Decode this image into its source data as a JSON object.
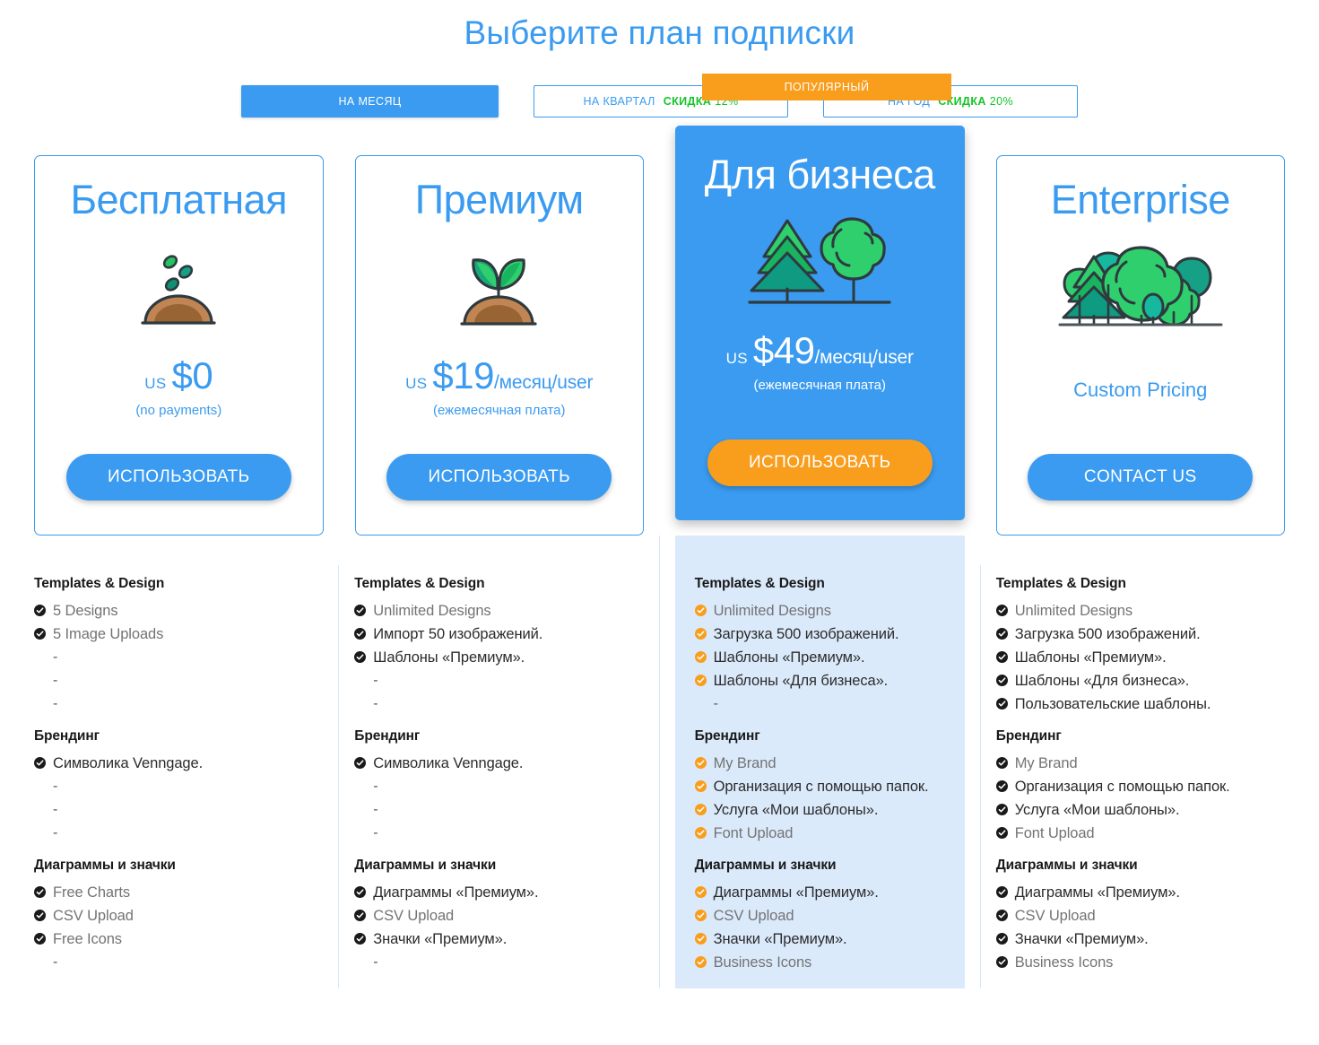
{
  "header": {
    "title": "Выберите план подписки"
  },
  "billing": {
    "options": [
      {
        "label": "НА МЕСЯЦ",
        "discount_word": "",
        "discount_value": "",
        "active": true
      },
      {
        "label": "НА КВАРТАЛ",
        "discount_word": "СКИДКА",
        "discount_value": "12%",
        "active": false
      },
      {
        "label": "НА ГОД",
        "discount_word": "СКИДКА",
        "discount_value": "20%",
        "active": false
      }
    ]
  },
  "colors": {
    "accent_blue": "#3a9bf0",
    "accent_orange": "#f99d1c",
    "discount_green": "#16c42b",
    "highlight_bg": "#dbeafb"
  },
  "plans": [
    {
      "name": "Бесплатная",
      "illustration": "seeds-on-soil-icon",
      "currency": "US",
      "price": "$0",
      "period": "",
      "note": "(no payments)",
      "cta_label": "ИСПОЛЬЗОВАТЬ",
      "cta_style": "blue",
      "badge": "",
      "featured": false
    },
    {
      "name": "Премиум",
      "illustration": "sprout-icon",
      "currency": "US",
      "price": "$19",
      "period": "/месяц/user",
      "note": "(ежемесячная плата)",
      "cta_label": "ИСПОЛЬЗОВАТЬ",
      "cta_style": "blue",
      "badge": "",
      "featured": false
    },
    {
      "name": "Для бизнеса",
      "illustration": "two-trees-icon",
      "currency": "US",
      "price": "$49",
      "period": "/месяц/user",
      "note": "(ежемесячная плата)",
      "cta_label": "ИСПОЛЬЗОВАТЬ",
      "cta_style": "orange",
      "badge": "ПОПУЛЯРНЫЙ",
      "featured": true
    },
    {
      "name": "Enterprise",
      "illustration": "forest-icon",
      "currency": "",
      "price": "",
      "period": "",
      "note": "",
      "custom_price": "Custom Pricing",
      "cta_label": "CONTACT US",
      "cta_style": "blue",
      "badge": "",
      "featured": false
    }
  ],
  "features": [
    {
      "groups": [
        {
          "title": "Templates & Design",
          "items": [
            {
              "text": "5 Designs",
              "checked": true,
              "muted": true
            },
            {
              "text": "5 Image Uploads",
              "checked": true,
              "muted": true
            },
            {
              "text": "-",
              "checked": false
            },
            {
              "text": "-",
              "checked": false
            },
            {
              "text": "-",
              "checked": false
            }
          ]
        },
        {
          "title": "Брендинг",
          "items": [
            {
              "text": "Символика Venngage.",
              "checked": true,
              "muted": false
            },
            {
              "text": "-",
              "checked": false
            },
            {
              "text": "-",
              "checked": false
            },
            {
              "text": "-",
              "checked": false
            }
          ]
        },
        {
          "title": "Диаграммы и значки",
          "items": [
            {
              "text": "Free Charts",
              "checked": true,
              "muted": true
            },
            {
              "text": "CSV Upload",
              "checked": true,
              "muted": true
            },
            {
              "text": "Free Icons",
              "checked": true,
              "muted": true
            },
            {
              "text": "-",
              "checked": false
            }
          ]
        }
      ]
    },
    {
      "groups": [
        {
          "title": "Templates & Design",
          "items": [
            {
              "text": "Unlimited Designs",
              "checked": true,
              "muted": true
            },
            {
              "text": "Импорт 50 изображений.",
              "checked": true,
              "muted": false
            },
            {
              "text": "Шаблоны «Премиум».",
              "checked": true,
              "muted": false
            },
            {
              "text": "-",
              "checked": false
            },
            {
              "text": "-",
              "checked": false
            }
          ]
        },
        {
          "title": "Брендинг",
          "items": [
            {
              "text": "Символика Venngage.",
              "checked": true,
              "muted": false
            },
            {
              "text": "-",
              "checked": false
            },
            {
              "text": "-",
              "checked": false
            },
            {
              "text": "-",
              "checked": false
            }
          ]
        },
        {
          "title": "Диаграммы и значки",
          "items": [
            {
              "text": "Диаграммы «Премиум».",
              "checked": true,
              "muted": false
            },
            {
              "text": "CSV Upload",
              "checked": true,
              "muted": true
            },
            {
              "text": "Значки «Премиум».",
              "checked": true,
              "muted": false
            },
            {
              "text": "-",
              "checked": false
            }
          ]
        }
      ]
    },
    {
      "highlight": true,
      "check_color": "orange",
      "groups": [
        {
          "title": "Templates & Design",
          "items": [
            {
              "text": "Unlimited Designs",
              "checked": true,
              "muted": true
            },
            {
              "text": "Загрузка 500 изображений.",
              "checked": true,
              "muted": false
            },
            {
              "text": "Шаблоны «Премиум».",
              "checked": true,
              "muted": false
            },
            {
              "text": "Шаблоны «Для бизнеса».",
              "checked": true,
              "muted": false
            },
            {
              "text": "-",
              "checked": false
            }
          ]
        },
        {
          "title": "Брендинг",
          "items": [
            {
              "text": "My Brand",
              "checked": true,
              "muted": true
            },
            {
              "text": "Организация с помощью папок.",
              "checked": true,
              "muted": false
            },
            {
              "text": "Услуга «Мои шаблоны».",
              "checked": true,
              "muted": false
            },
            {
              "text": "Font Upload",
              "checked": true,
              "muted": true
            }
          ]
        },
        {
          "title": "Диаграммы и значки",
          "items": [
            {
              "text": "Диаграммы «Премиум».",
              "checked": true,
              "muted": false
            },
            {
              "text": "CSV Upload",
              "checked": true,
              "muted": true
            },
            {
              "text": "Значки «Премиум».",
              "checked": true,
              "muted": false
            },
            {
              "text": "Business Icons",
              "checked": true,
              "muted": true
            }
          ]
        }
      ]
    },
    {
      "groups": [
        {
          "title": "Templates & Design",
          "items": [
            {
              "text": "Unlimited Designs",
              "checked": true,
              "muted": true
            },
            {
              "text": "Загрузка 500 изображений.",
              "checked": true,
              "muted": false
            },
            {
              "text": "Шаблоны «Премиум».",
              "checked": true,
              "muted": false
            },
            {
              "text": "Шаблоны «Для бизнеса».",
              "checked": true,
              "muted": false
            },
            {
              "text": "Пользовательские шаблоны.",
              "checked": true,
              "muted": false
            }
          ]
        },
        {
          "title": "Брендинг",
          "items": [
            {
              "text": "My Brand",
              "checked": true,
              "muted": true
            },
            {
              "text": "Организация с помощью папок.",
              "checked": true,
              "muted": false
            },
            {
              "text": "Услуга «Мои шаблоны».",
              "checked": true,
              "muted": false
            },
            {
              "text": "Font Upload",
              "checked": true,
              "muted": true
            }
          ]
        },
        {
          "title": "Диаграммы и значки",
          "items": [
            {
              "text": "Диаграммы «Премиум».",
              "checked": true,
              "muted": false
            },
            {
              "text": "CSV Upload",
              "checked": true,
              "muted": true
            },
            {
              "text": "Значки «Премиум».",
              "checked": true,
              "muted": false
            },
            {
              "text": "Business Icons",
              "checked": true,
              "muted": true
            }
          ]
        }
      ]
    }
  ]
}
